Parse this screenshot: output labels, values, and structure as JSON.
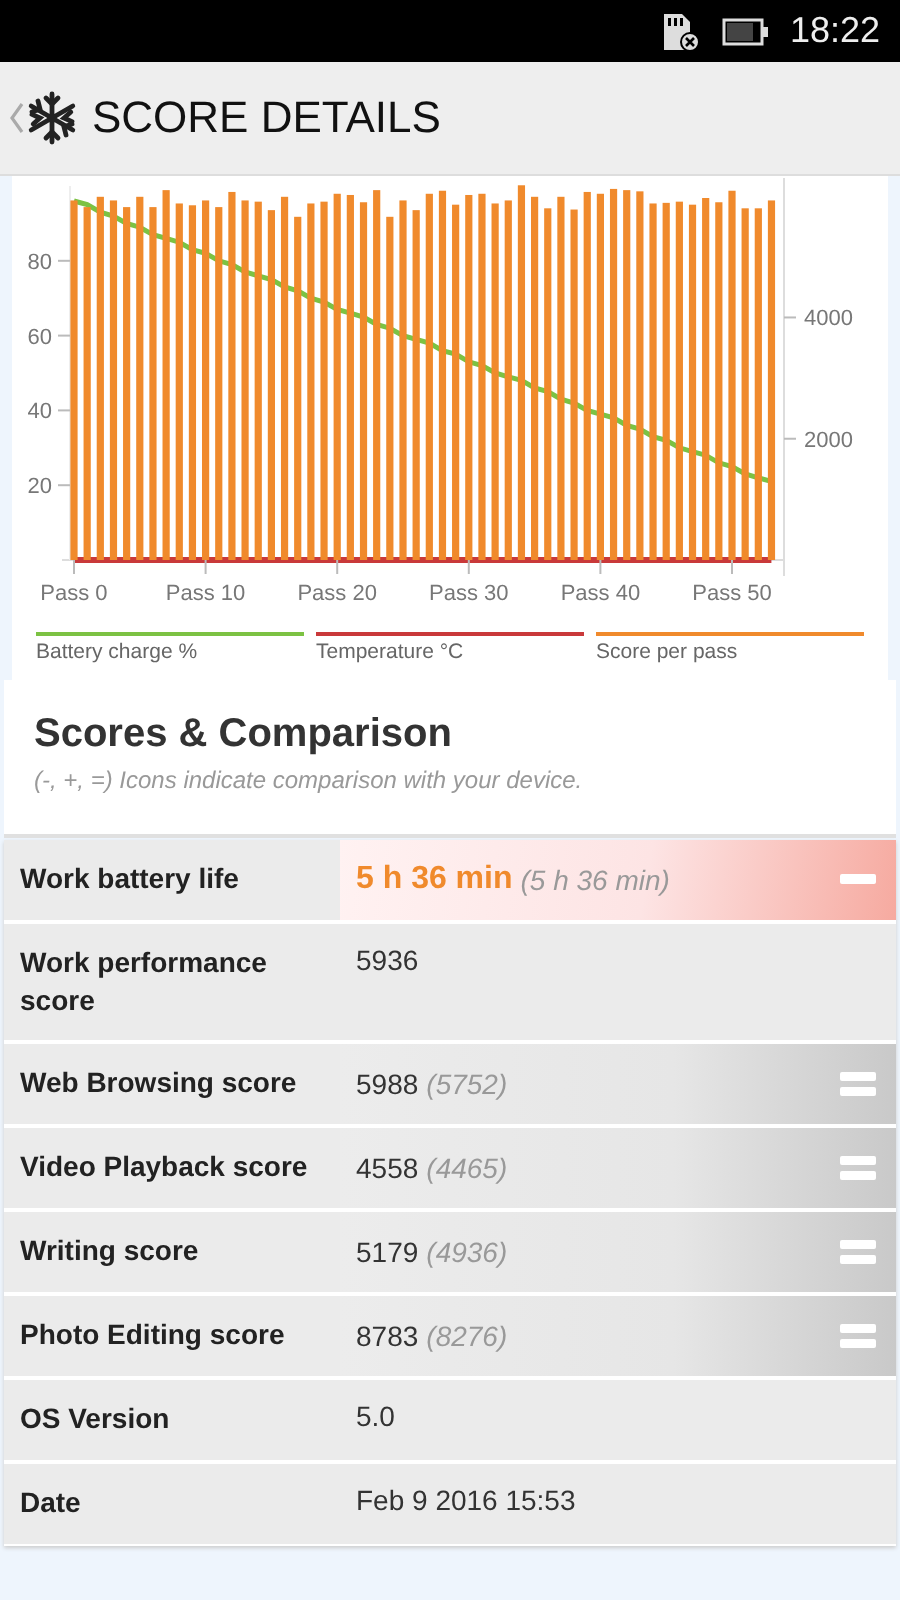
{
  "status_bar": {
    "time": "18:22"
  },
  "header": {
    "title": "SCORE DETAILS"
  },
  "chart": {
    "scores": {
      "chart_data": {
        "type": "bar",
        "categories": [
          "Pass 0",
          null,
          null,
          null,
          null,
          null,
          null,
          null,
          null,
          null,
          "Pass 10",
          null,
          null,
          null,
          null,
          null,
          null,
          null,
          null,
          null,
          "Pass 20",
          null,
          null,
          null,
          null,
          null,
          null,
          null,
          null,
          null,
          "Pass 30",
          null,
          null,
          null,
          null,
          null,
          null,
          null,
          null,
          null,
          "Pass 40",
          null,
          null,
          null,
          null,
          null,
          null,
          null,
          null,
          null,
          "Pass 50",
          null,
          null,
          null
        ],
        "ylim": [
          0,
          6300
        ],
        "yticks": [
          {
            "value": 2000,
            "label": "2000"
          },
          {
            "value": 4000,
            "label": "4000"
          }
        ],
        "series": [
          {
            "name": "Score per pass",
            "color": "#f08a2c",
            "values": [
              5930,
              5820,
              5990,
              5930,
              5820,
              5990,
              5820,
              6100,
              5880,
              5850,
              5930,
              5820,
              6070,
              5930,
              5910,
              5770,
              5990,
              5660,
              5880,
              5910,
              6040,
              6020,
              5900,
              6100,
              5660,
              5930,
              5770,
              6040,
              6090,
              5860,
              6020,
              6040,
              5880,
              5930,
              6180,
              5990,
              5800,
              5990,
              5780,
              6070,
              6040,
              6120,
              6100,
              6080,
              5880,
              5890,
              5910,
              5860,
              5970,
              5900,
              6090,
              5800,
              5800,
              5930
            ]
          }
        ]
      }
    },
    "battery": {
      "chart_data": {
        "type": "line",
        "ylim": [
          0,
          100
        ],
        "yticks": [
          20,
          40,
          60,
          80
        ],
        "series": [
          {
            "name": "Battery charge %",
            "color": "#7cc243",
            "values": [
              96,
              95,
              93,
              92,
              90,
              89,
              87,
              86,
              85,
              83,
              82,
              80,
              79,
              77,
              76,
              75,
              73,
              72,
              70,
              69,
              67,
              66,
              65,
              63,
              62,
              60,
              59,
              58,
              56,
              55,
              53,
              52,
              50,
              49,
              48,
              46,
              45,
              43,
              42,
              40,
              39,
              38,
              36,
              35,
              33,
              32,
              30,
              29,
              28,
              26,
              25,
              23,
              22,
              21
            ]
          },
          {
            "name": "Temperature °C",
            "color": "#c9393a",
            "values": [
              0,
              0,
              0,
              0,
              0,
              0,
              0,
              0,
              0,
              0,
              0,
              0,
              0,
              0,
              0,
              0,
              0,
              0,
              0,
              0,
              0,
              0,
              0,
              0,
              0,
              0,
              0,
              0,
              0,
              0,
              0,
              0,
              0,
              0,
              0,
              0,
              0,
              0,
              0,
              0,
              0,
              0,
              0,
              0,
              0,
              0,
              0,
              0,
              0,
              0,
              0,
              0,
              0,
              0
            ]
          }
        ]
      }
    }
  },
  "section": {
    "title": "Scores & Comparison",
    "subtitle": "(-, +, =) Icons indicate comparison with your device."
  },
  "rows": [
    {
      "label": "Work battery life",
      "value": "5 h 36 min",
      "reference": "(5 h 36 min)",
      "kind": "worse"
    },
    {
      "label": "Work performance score",
      "value": "5936",
      "kind": "plain"
    },
    {
      "label": "Web Browsing score",
      "value": "5988",
      "reference": "(5752)",
      "kind": "equal"
    },
    {
      "label": "Video Playback score",
      "value": "4558",
      "reference": "(4465)",
      "kind": "equal"
    },
    {
      "label": "Writing score",
      "value": "5179",
      "reference": "(4936)",
      "kind": "equal"
    },
    {
      "label": "Photo Editing score",
      "value": "8783",
      "reference": "(8276)",
      "kind": "equal"
    },
    {
      "label": "OS Version",
      "value": "5.0",
      "kind": "plain"
    },
    {
      "label": "Date",
      "value": "Feb 9 2016 15:53",
      "kind": "plain"
    }
  ]
}
